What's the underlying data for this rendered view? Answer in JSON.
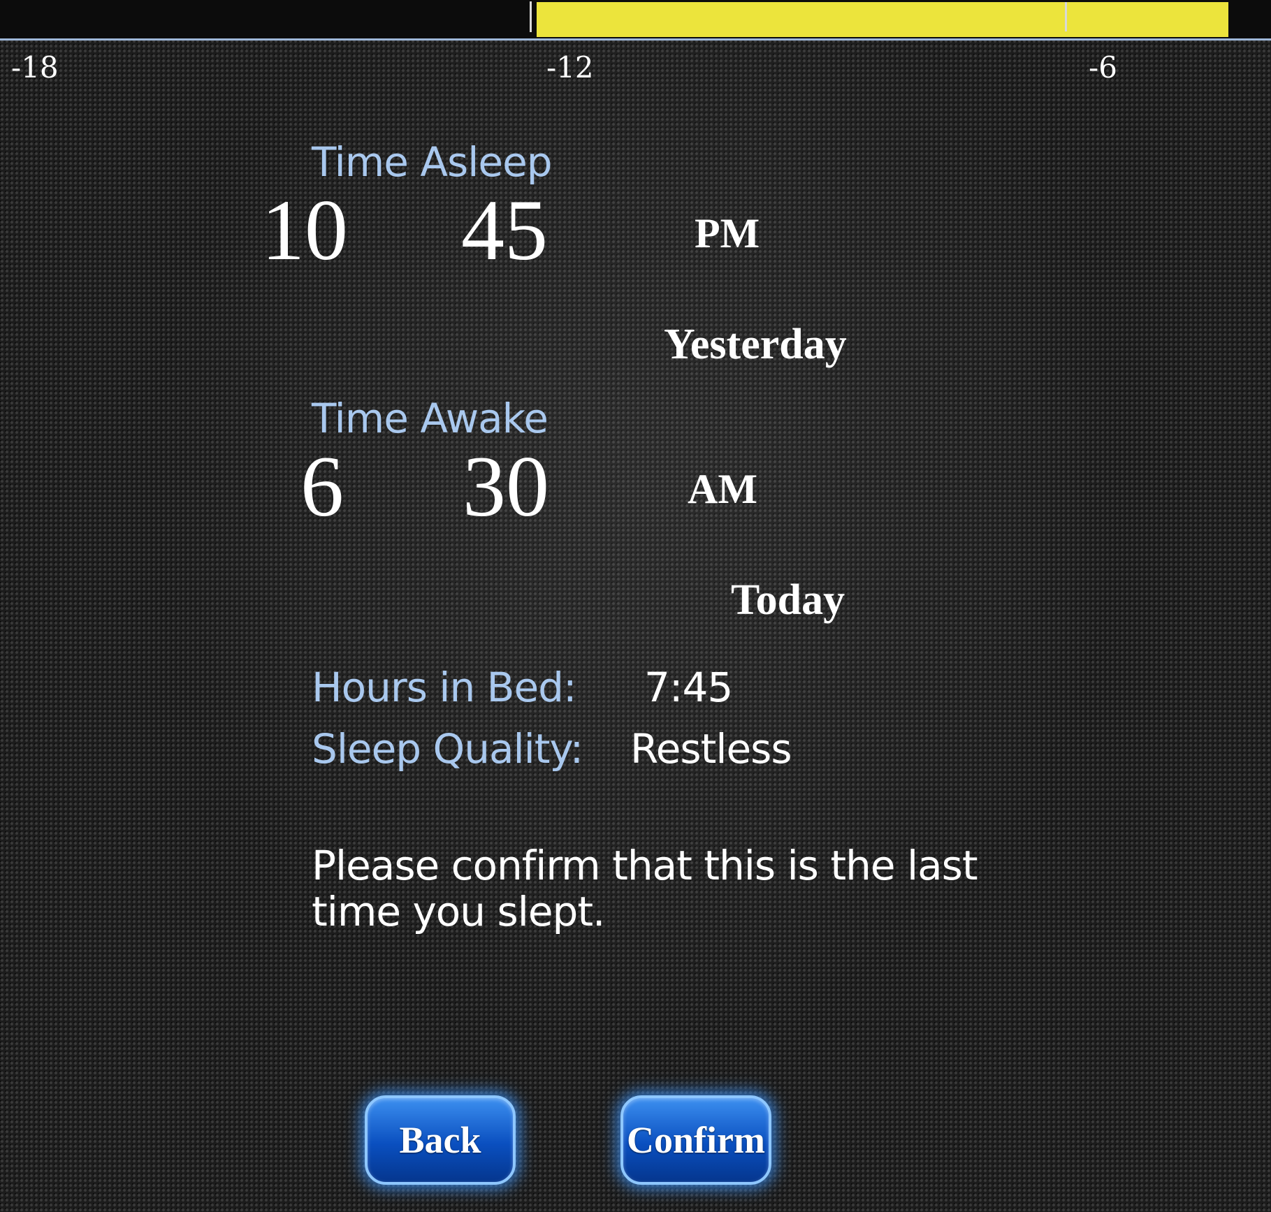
{
  "timeline": {
    "tick_labels": [
      "-18",
      "-12",
      "-6"
    ]
  },
  "asleep": {
    "title": "Time Asleep",
    "hour": "10",
    "minute": "45",
    "meridiem": "PM",
    "day": "Yesterday"
  },
  "awake": {
    "title": "Time Awake",
    "hour": "6",
    "minute": "30",
    "meridiem": "AM",
    "day": "Today"
  },
  "summary": {
    "hours_label": "Hours in Bed:",
    "hours_value": "7:45",
    "quality_label": "Sleep Quality:",
    "quality_value": "Restless"
  },
  "message": "Please confirm that this is the last time you slept.",
  "buttons": {
    "back": "Back",
    "confirm": "Confirm"
  },
  "colors": {
    "accent_label": "#a9c8ee",
    "timeline_fill": "#ece43c",
    "button": "#0a4fbf"
  }
}
